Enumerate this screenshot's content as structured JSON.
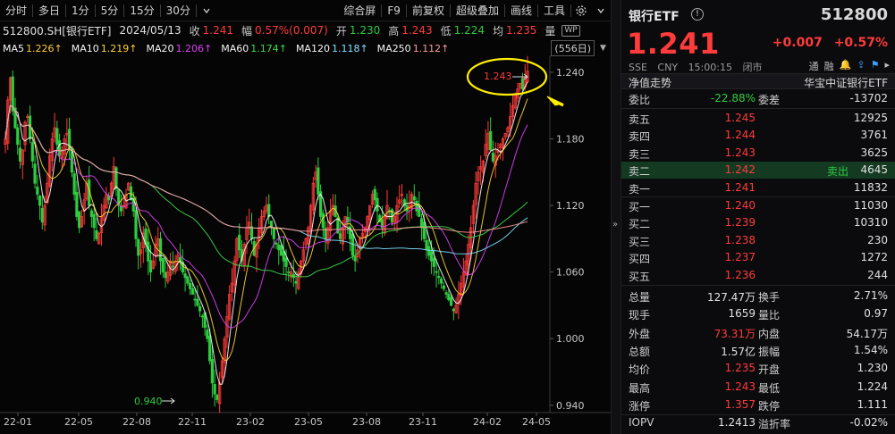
{
  "toolbar": {
    "items_left": [
      "分时",
      "多日",
      "1分",
      "5分",
      "15分",
      "30分"
    ],
    "dropdown_icon": "chevron-down-icon",
    "items_right": [
      "综合屏",
      "F9",
      "前复权",
      "超级叠加",
      "画线",
      "工具"
    ],
    "settings_icon": "gear-icon"
  },
  "info": {
    "symbol": "512800.SH[银行ETF]",
    "date": "2024/05/13",
    "close_label": "收",
    "close": "1.241",
    "amp_label": "幅",
    "amp": "0.57%(0.007)",
    "open_label": "开",
    "open": "1.230",
    "high_label": "高",
    "high": "1.243",
    "low_label": "低",
    "low": "1.224",
    "avg_label": "均",
    "avg": "1.235",
    "vol_label": "量",
    "wp": "WP"
  },
  "ma": {
    "items": [
      {
        "label": "MA5",
        "value": "1.226↑",
        "color": "#f5f5f5",
        "value_color": "#ffcc33"
      },
      {
        "label": "MA10",
        "value": "1.219↑",
        "color": "#f5f5f5",
        "value_color": "#ffd633"
      },
      {
        "label": "MA20",
        "value": "1.206↑",
        "color": "#f5f5f5",
        "value_color": "#e040fb"
      },
      {
        "label": "MA60",
        "value": "1.174↑",
        "color": "#f5f5f5",
        "value_color": "#3ddc4a"
      },
      {
        "label": "MA120",
        "value": "1.118↑",
        "color": "#f5f5f5",
        "value_color": "#7fe0ff"
      },
      {
        "label": "MA250",
        "value": "1.112↑",
        "color": "#f5f5f5",
        "value_color": "#ff9a9a"
      }
    ],
    "count": "(556日)"
  },
  "chart_data": {
    "type": "candlestick",
    "x_ticks": [
      "22-01",
      "22-05",
      "22-08",
      "22-11",
      "23-02",
      "23-05",
      "23-08",
      "23-11",
      "24-02",
      "24-05"
    ],
    "y_ticks": [
      "1.240",
      "1.180",
      "1.120",
      "1.060",
      "1.000",
      "0.940"
    ],
    "ylim": [
      0.935,
      1.252
    ],
    "annotations": {
      "high_label": "1.243",
      "low_label": "0.940"
    },
    "colors": {
      "up": "#ff3b3b",
      "down": "#2ecc40",
      "ma5": "#ffffff",
      "ma10": "#ffd633",
      "ma20": "#e040fb",
      "ma60": "#3ddc4a",
      "ma120": "#7fe0ff",
      "ma250": "#ff9a9a",
      "highlight": "#ffee00"
    },
    "close_series": [
      1.18,
      1.215,
      1.235,
      1.205,
      1.19,
      1.175,
      1.16,
      1.17,
      1.195,
      1.2,
      1.18,
      1.16,
      1.14,
      1.13,
      1.12,
      1.105,
      1.12,
      1.14,
      1.165,
      1.18,
      1.19,
      1.175,
      1.165,
      1.17,
      1.18,
      1.185,
      1.17,
      1.15,
      1.13,
      1.11,
      1.1,
      1.11,
      1.125,
      1.14,
      1.12,
      1.11,
      1.1,
      1.09,
      1.095,
      1.11,
      1.12,
      1.13,
      1.125,
      1.14,
      1.155,
      1.135,
      1.12,
      1.115,
      1.12,
      1.13,
      1.14,
      1.125,
      1.115,
      1.09,
      1.075,
      1.08,
      1.095,
      1.085,
      1.07,
      1.06,
      1.07,
      1.085,
      1.09,
      1.07,
      1.06,
      1.055,
      1.06,
      1.07,
      1.065,
      1.07,
      1.075,
      1.07,
      1.06,
      1.055,
      1.05,
      1.045,
      1.04,
      1.035,
      1.03,
      1.025,
      1.02,
      1.01,
      1.0,
      0.98,
      0.96,
      0.95,
      0.945,
      0.96,
      0.98,
      1.0,
      1.02,
      1.04,
      1.05,
      1.07,
      1.09,
      1.08,
      1.07,
      1.085,
      1.1,
      1.105,
      1.09,
      1.075,
      1.085,
      1.1,
      1.11,
      1.115,
      1.12,
      1.11,
      1.1,
      1.09,
      1.085,
      1.08,
      1.075,
      1.07,
      1.065,
      1.06,
      1.06,
      1.055,
      1.05,
      1.06,
      1.07,
      1.08,
      1.09,
      1.1,
      1.12,
      1.14,
      1.15,
      1.13,
      1.11,
      1.1,
      1.09,
      1.1,
      1.115,
      1.12,
      1.11,
      1.095,
      1.09,
      1.1,
      1.11,
      1.105,
      1.09,
      1.075,
      1.07,
      1.08,
      1.09,
      1.095,
      1.1,
      1.11,
      1.12,
      1.13,
      1.125,
      1.115,
      1.105,
      1.1,
      1.11,
      1.12,
      1.115,
      1.105,
      1.11,
      1.12,
      1.125,
      1.13,
      1.12,
      1.115,
      1.12,
      1.13,
      1.125,
      1.115,
      1.11,
      1.1,
      1.09,
      1.08,
      1.075,
      1.07,
      1.065,
      1.06,
      1.055,
      1.05,
      1.045,
      1.04,
      1.035,
      1.03,
      1.025,
      1.03,
      1.04,
      1.05,
      1.06,
      1.07,
      1.085,
      1.1,
      1.12,
      1.14,
      1.15,
      1.155,
      1.16,
      1.175,
      1.185,
      1.17,
      1.16,
      1.165,
      1.17,
      1.175,
      1.18,
      1.185,
      1.19,
      1.2,
      1.21,
      1.22,
      1.225,
      1.23,
      1.225,
      1.235,
      1.241
    ]
  },
  "quote": {
    "name": "银行ETF",
    "code": "512800",
    "price": "1.241",
    "change": "+0.007",
    "change_pct": "+0.57%",
    "exchange": "SSE",
    "currency": "CNY",
    "time": "15:00:15",
    "status": "闭市",
    "icons": [
      "通",
      "融"
    ],
    "nav_label": "净值走势",
    "nav_name": "华宝中证银行ETF",
    "webi_label": "委比",
    "webi": "-22.88%",
    "weicha_label": "委差",
    "weicha": "-13702",
    "asks": [
      {
        "label": "卖五",
        "price": "1.245",
        "vol": "12925",
        "tag": ""
      },
      {
        "label": "卖四",
        "price": "1.244",
        "vol": "3761",
        "tag": ""
      },
      {
        "label": "卖三",
        "price": "1.243",
        "vol": "3625",
        "tag": ""
      },
      {
        "label": "卖二",
        "price": "1.242",
        "vol": "4645",
        "tag": "卖出"
      },
      {
        "label": "卖一",
        "price": "1.241",
        "vol": "11832",
        "tag": ""
      }
    ],
    "bids": [
      {
        "label": "买一",
        "price": "1.240",
        "vol": "11030"
      },
      {
        "label": "买二",
        "price": "1.239",
        "vol": "10310"
      },
      {
        "label": "买三",
        "price": "1.238",
        "vol": "230"
      },
      {
        "label": "买四",
        "price": "1.237",
        "vol": "1272"
      },
      {
        "label": "买五",
        "price": "1.236",
        "vol": "244"
      }
    ],
    "stats": [
      {
        "l1": "总量",
        "v1": "127.47万",
        "c1": "white",
        "l2": "换手",
        "v2": "2.71%",
        "c2": "white"
      },
      {
        "l1": "现手",
        "v1": "1659",
        "c1": "white",
        "l2": "量比",
        "v2": "0.97",
        "c2": "white"
      },
      {
        "l1": "外盘",
        "v1": "73.31万",
        "c1": "red",
        "l2": "内盘",
        "v2": "54.17万",
        "c2": "green"
      },
      {
        "l1": "总额",
        "v1": "1.57亿",
        "c1": "white",
        "l2": "振幅",
        "v2": "1.54%",
        "c2": "white"
      },
      {
        "l1": "均价",
        "v1": "1.235",
        "c1": "red",
        "l2": "开盘",
        "v2": "1.230",
        "c2": "green"
      },
      {
        "l1": "最高",
        "v1": "1.243",
        "c1": "red",
        "l2": "最低",
        "v2": "1.224",
        "c2": "green"
      },
      {
        "l1": "涨停",
        "v1": "1.357",
        "c1": "red",
        "l2": "跌停",
        "v2": "1.111",
        "c2": "green"
      },
      {
        "l1": "IOPV",
        "v1": "1.2413",
        "c1": "white",
        "l2": "溢折率",
        "v2": "-0.02%",
        "c2": "green"
      }
    ]
  }
}
